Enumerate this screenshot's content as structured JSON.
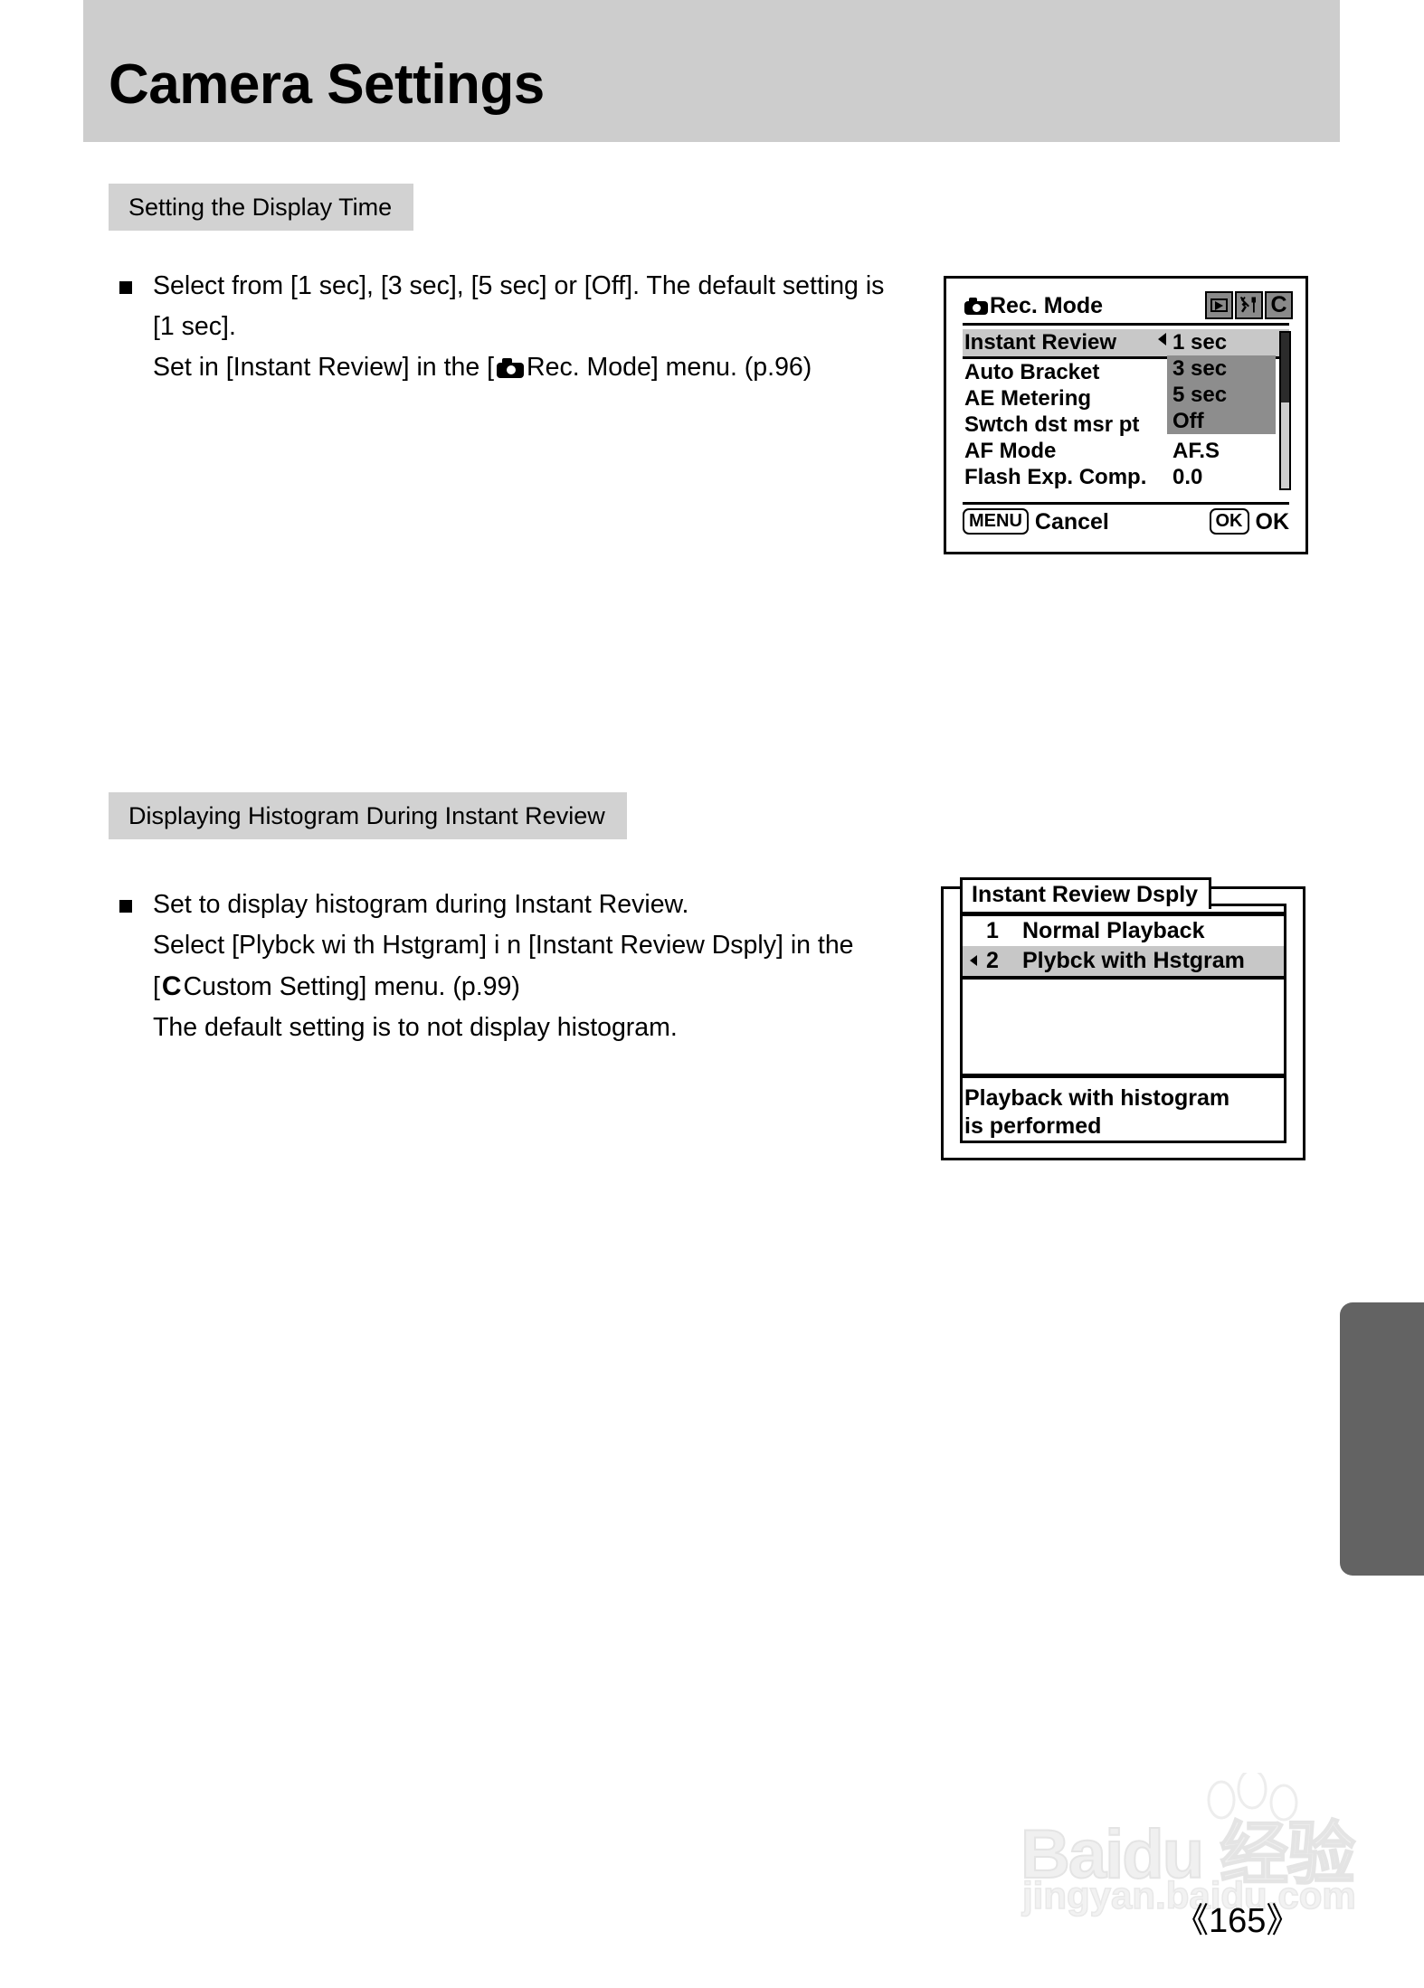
{
  "page": {
    "title": "Camera Settings",
    "number": "《165》",
    "watermark": {
      "brand": "Baidu 经验",
      "url": "jingyan.baidu.com"
    }
  },
  "sections": [
    {
      "heading": "Setting the Display Time",
      "body": {
        "line1": "Select from [1 sec], [3 sec], [5 sec] or [Off]. The default setting is",
        "line2": "[1 sec].",
        "line3_a": "Set in [Instant Review] in the [",
        "line3_icon": "camera-icon",
        "line3_b": "Rec. Mode] menu. (p.96)"
      }
    },
    {
      "heading": "Displaying Histogram During Instant Review",
      "body": {
        "line1": "Set to display histogram during Instant Review.",
        "line2": "Select [Plybck wi th Hstgram] i n [Instant Review Dsply] in the",
        "line3_a": "[",
        "line3_icon": "C",
        "line3_b": "Custom Setting] menu. (p.99)",
        "line4": "The default setting is to not display histogram."
      }
    }
  ],
  "lcd_rec_mode": {
    "title": "Rec. Mode",
    "title_icon": "camera-icon",
    "tabs": [
      {
        "name": "playback-tab",
        "icon": "play-icon",
        "label": ""
      },
      {
        "name": "setup-tab",
        "icon": "wrench-screwdriver-icon",
        "label": ""
      },
      {
        "name": "custom-tab",
        "icon": "c-letter-icon",
        "label": "C"
      }
    ],
    "rows": [
      {
        "label": "Instant Review",
        "value": "1 sec",
        "selected": true
      },
      {
        "label": "Auto Bracket",
        "value": "",
        "selected": false
      },
      {
        "label": "AE Metering",
        "value": "",
        "selected": false
      },
      {
        "label": "Swtch dst msr pt",
        "value": "",
        "selected": false
      },
      {
        "label": "AF Mode",
        "value": "AF.S",
        "selected": false
      },
      {
        "label": "Flash Exp. Comp.",
        "value": "0.0",
        "selected": false
      }
    ],
    "dropdown": {
      "selected": "1 sec",
      "options": [
        "3 sec",
        "5 sec",
        "Off"
      ]
    },
    "footer": {
      "left_button": "MENU",
      "left_label": "Cancel",
      "right_button": "OK",
      "right_label": "OK"
    }
  },
  "lcd_review_dsply": {
    "title": "Instant Review Dsply",
    "options": [
      {
        "num": "1",
        "label": "Normal Playback",
        "selected": false
      },
      {
        "num": "2",
        "label": "Plybck with Hstgram",
        "selected": true
      }
    ],
    "description": {
      "line1": "Playback with histogram",
      "line2": "is performed"
    }
  },
  "colors": {
    "banner": "#cdcdcd",
    "chip": "#d2d2d2",
    "edge_tab": "#636363",
    "lcd_highlight": "#c8c8c8",
    "lcd_dropdown": "#8d8d8d"
  }
}
